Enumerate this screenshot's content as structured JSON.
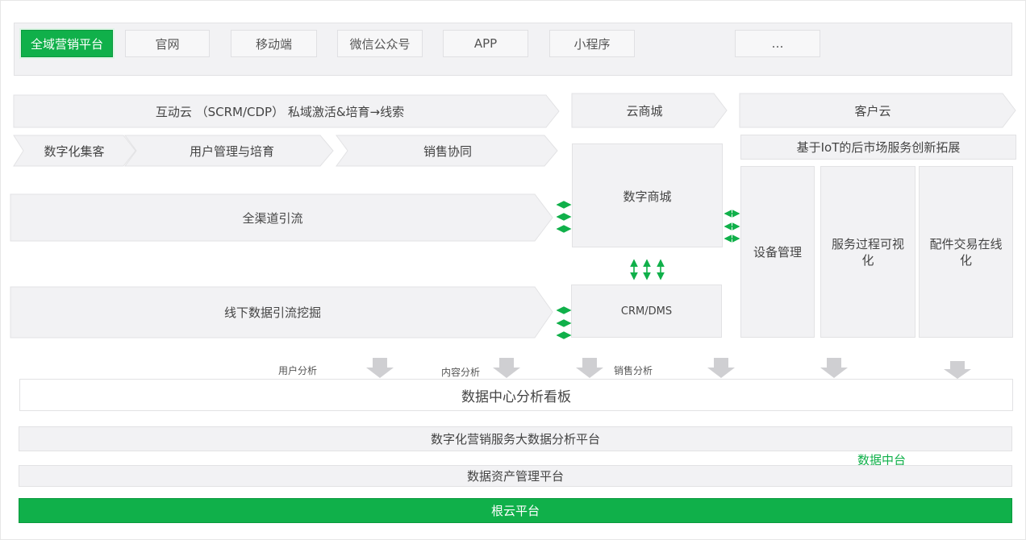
{
  "top_bar": {
    "tabs": [
      "全域营销平台",
      "官网",
      "移动端",
      "微信公众号",
      "APP",
      "小程序",
      "…"
    ]
  },
  "row1": {
    "interactive_cloud": "互动云 （SCRM/CDP） 私域激活&培育→线索",
    "cloud_mall": "云商城",
    "customer_cloud": "客户云"
  },
  "row2": {
    "steps": [
      "数字化集客",
      "用户管理与培育",
      "销售协同"
    ],
    "iot": "基于IoT的后市场服务创新拓展"
  },
  "middle": {
    "all_channel": "全渠道引流",
    "offline": "线下数据引流挖掘",
    "digital_mall": "数字商城",
    "crm": "CRM/DMS",
    "service_cols": [
      "设备管理",
      "服务过程可视化",
      "配件交易在线化"
    ]
  },
  "analysis_labels": [
    "用户分析",
    "内容分析",
    "销售分析"
  ],
  "dashboard": "数据中心分析看板",
  "platforms": {
    "bigdata": "数字化营销服务大数据分析平台",
    "asset": "数据资产管理平台",
    "data_center": "数据中台",
    "root": "根云平台"
  },
  "colors": {
    "green": "#10b04a",
    "panel": "#f2f2f4",
    "border": "#e2e2e4"
  }
}
